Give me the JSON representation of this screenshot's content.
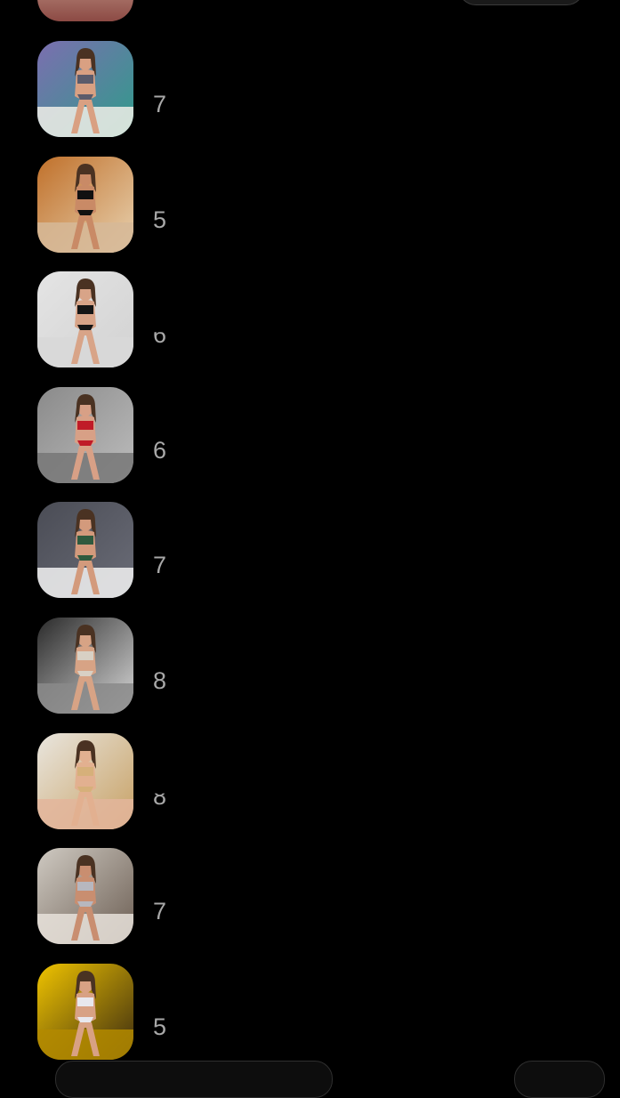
{
  "rows": [
    {
      "count": "7",
      "bg": "#7c6eb0",
      "bg2": "#2e9c8a",
      "skin": "#d9a082",
      "outfit": "#5b5b6b",
      "floor": "#f0eee8"
    },
    {
      "count": "5",
      "bg": "#c0702a",
      "bg2": "#e8d2b0",
      "skin": "#c98a66",
      "outfit": "#111111",
      "floor": "#d6b898"
    },
    {
      "count": "6",
      "bg": "#e4e4e4",
      "bg2": "#d2d2d2",
      "skin": "#d8a488",
      "outfit": "#151515",
      "floor": "#d8d8d8"
    },
    {
      "count": "6",
      "bg": "#8a8a8a",
      "bg2": "#bdbdbd",
      "skin": "#d8a086",
      "outfit": "#c01b28",
      "floor": "#777777"
    },
    {
      "count": "7",
      "bg": "#4a4c55",
      "bg2": "#6b6d78",
      "skin": "#d39a7c",
      "outfit": "#2f5a3e",
      "floor": "#f2f2f2"
    },
    {
      "count": "8",
      "bg": "#2a2a2a",
      "bg2": "#d9d9d9",
      "skin": "#d7a385",
      "outfit": "#d8d0c4",
      "floor": "#8a8a8a"
    },
    {
      "count": "8",
      "bg": "#e9e6df",
      "bg2": "#c7a063",
      "skin": "#e2b090",
      "outfit": "#d6b07a",
      "floor": "#e3b59b"
    },
    {
      "count": "7",
      "bg": "#cfcac2",
      "bg2": "#6b5d52",
      "skin": "#c98e70",
      "outfit": "#b7b7bf",
      "floor": "#e8e2da"
    },
    {
      "count": "5",
      "bg": "#f0c400",
      "bg2": "#3a2a10",
      "skin": "#d8a184",
      "outfit": "#e8e8ee",
      "floor": "#b38a00"
    }
  ]
}
